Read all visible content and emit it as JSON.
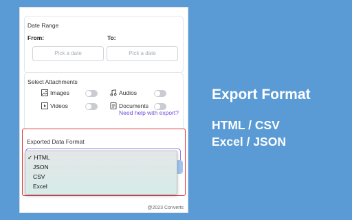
{
  "date_range": {
    "title": "Date Range",
    "from_label": "From:",
    "to_label": "To:",
    "from_placeholder": "Pick a date",
    "to_placeholder": "Pick a date"
  },
  "attachments": {
    "title": "Select Attachments",
    "items": [
      {
        "label": "Images",
        "icon": "image-icon",
        "enabled": false
      },
      {
        "label": "Audios",
        "icon": "music-note-icon",
        "enabled": false
      },
      {
        "label": "Videos",
        "icon": "video-icon",
        "enabled": false
      },
      {
        "label": "Documents",
        "icon": "document-icon",
        "enabled": false
      }
    ],
    "help_link": "Need help with export?"
  },
  "export_format": {
    "title": "Exported Data Format",
    "options": [
      "HTML",
      "JSON",
      "CSV",
      "Excel"
    ],
    "selected": "HTML",
    "check_mark": "✓"
  },
  "footer": "@2023 Converts",
  "promo": {
    "title": "Export Format",
    "line1": "HTML / CSV",
    "line2": "Excel / JSON"
  },
  "colors": {
    "background": "#5b9bd5",
    "highlight_border": "#e0393e",
    "link": "#6f4fd6",
    "select_border": "#8e7de6"
  }
}
